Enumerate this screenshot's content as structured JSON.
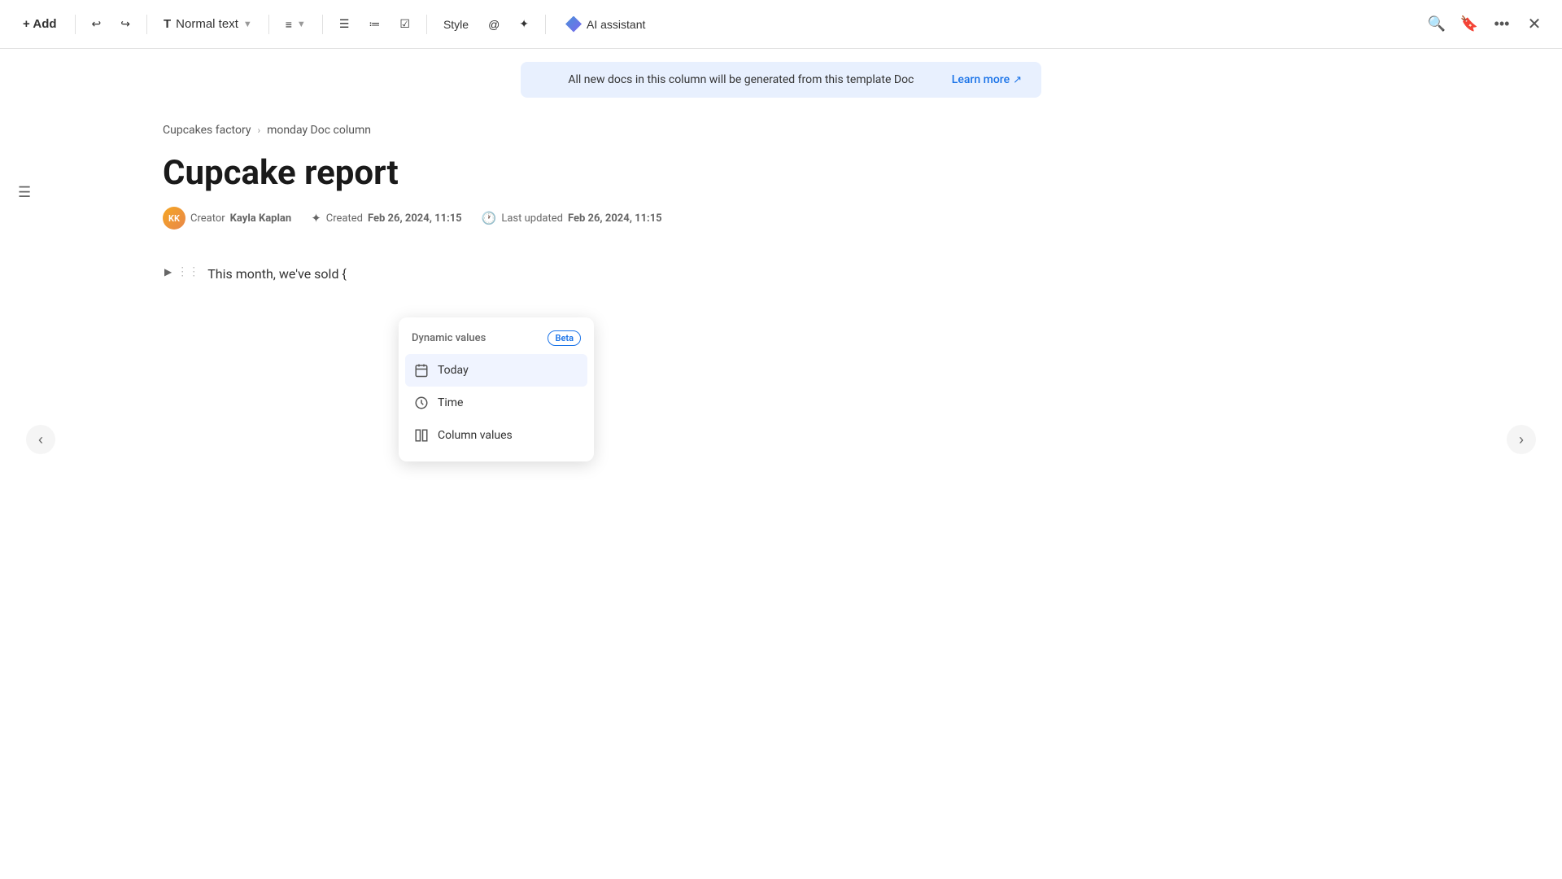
{
  "toolbar": {
    "add_label": "+ Add",
    "normal_text_label": "Normal text",
    "style_label": "Style",
    "ai_assistant_label": "AI assistant",
    "undo_icon": "↩",
    "redo_icon": "↪"
  },
  "banner": {
    "message": "All new docs in this column will be generated from this template Doc",
    "learn_more_label": "Learn more"
  },
  "breadcrumb": {
    "parent": "Cupcakes factory",
    "separator": "›",
    "current": "monday Doc column"
  },
  "document": {
    "title": "Cupcake report",
    "creator_label": "Creator",
    "creator_name": "Kayla Kaplan",
    "created_label": "Created",
    "created_date": "Feb 26, 2024, 11:15",
    "updated_label": "Last updated",
    "updated_date": "Feb 26, 2024, 11:15",
    "content_text": "This month, we've sold {"
  },
  "dynamic_values": {
    "header": "Dynamic values",
    "beta_label": "Beta",
    "items": [
      {
        "id": "today",
        "label": "Today",
        "icon": "📅"
      },
      {
        "id": "time",
        "label": "Time",
        "icon": "🕐"
      },
      {
        "id": "column-values",
        "label": "Column values",
        "icon": "📊"
      }
    ]
  },
  "colors": {
    "accent": "#1a73e8",
    "banner_bg": "#e8f0fe",
    "active_item_bg": "#f0f4ff"
  }
}
